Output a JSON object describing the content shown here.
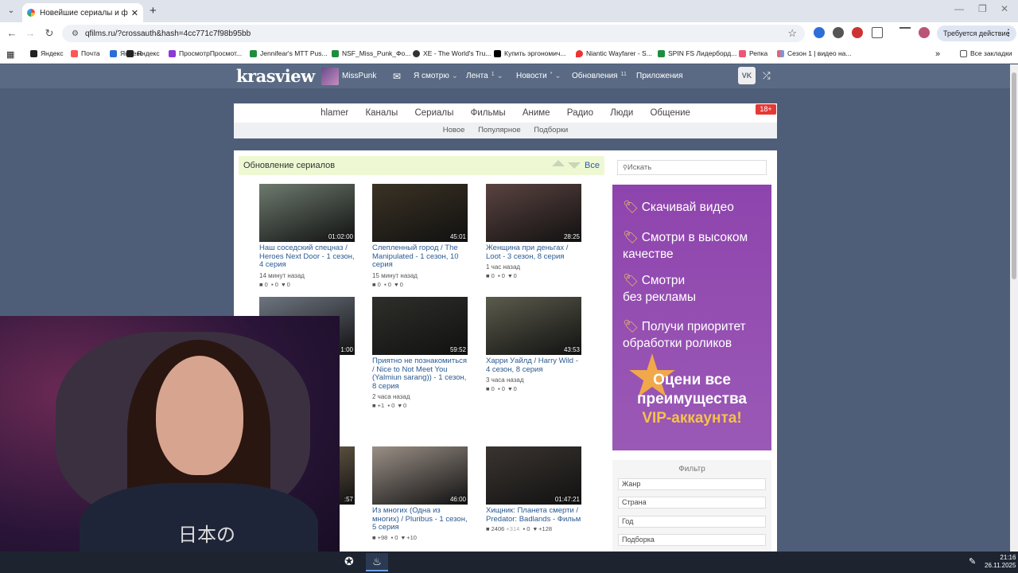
{
  "browser": {
    "tab_title": "Новейшие сериалы и фильмы",
    "url": "qfilms.ru/?crossauth&hash=4cc771c7f98b95bb",
    "action_required": "Требуется действие",
    "bookmarks": [
      "Яндекс",
      "Почта",
      "Яндекс",
      "ПросмотрПросмот...",
      "Jennifear's MTT Pus...",
      "NSF_Miss_Punk_Фо...",
      "XE - The World's Tru...",
      "Купить эргономич...",
      "Niantic Wayfarer - S...",
      "SPIN FS Лидерборд...",
      "Репка",
      "Сезон 1 | видео на..."
    ],
    "all_bookmarks": "Все закладки"
  },
  "header": {
    "logo": "krasview",
    "user": "MissPunk",
    "watching": "Я смотрю",
    "feed": "Лента",
    "feed_count": "1",
    "news": "Новости",
    "news_count": "*",
    "updates": "Обновления",
    "updates_count": "11",
    "apps": "Приложения",
    "vk": "VK"
  },
  "nav": {
    "primary": [
      "hlamer",
      "Каналы",
      "Сериалы",
      "Фильмы",
      "Аниме",
      "Радио",
      "Люди",
      "Общение"
    ],
    "secondary": [
      "Новое",
      "Популярное",
      "Подборки"
    ],
    "adult": "18+"
  },
  "section": {
    "title": "Обновление сериалов",
    "all": "Все"
  },
  "cards": [
    {
      "title": "Наш соседский спецназ / Heroes Next Door - 1 сезон, 4 серия",
      "time": "14 минут назад",
      "duration": "01:02:00",
      "views": "0",
      "comments": "0",
      "likes": "0",
      "color": "#6d7a6e"
    },
    {
      "title": "Слепленный город / The Manipulated - 1 сезон, 10 серия",
      "time": "15 минут назад",
      "duration": "45:01",
      "views": "0",
      "comments": "0",
      "likes": "0",
      "color": "#3b3224"
    },
    {
      "title": "Женщина при деньгах / Loot - 3 сезон, 8 серия",
      "time": "1 час назад",
      "duration": "28:25",
      "views": "0",
      "comments": "0",
      "likes": "0",
      "color": "#5a4340"
    },
    {
      "title": "",
      "time": "",
      "duration": "1:00",
      "views": "",
      "comments": "",
      "likes": "",
      "color": "#6e7580"
    },
    {
      "title": "Приятно не познакомиться / Nice to Not Meet You (Yalmiun sarang)) - 1 сезон, 8 серия",
      "time": "2 часа назад",
      "duration": "59:52",
      "views": "+1",
      "comments": "0",
      "likes": "0",
      "color": "#2e2f2a"
    },
    {
      "title": "Харри Уайлд / Harry Wild - 4 сезон, 8 серия",
      "time": "3 часа назад",
      "duration": "43:53",
      "views": "0",
      "comments": "0",
      "likes": "0",
      "color": "#5b5b4c"
    },
    {
      "title": "",
      "time": "",
      "duration": ":57",
      "views": "",
      "comments": "",
      "likes": "",
      "color": "#7a6a52"
    },
    {
      "title": "Из многих (Одна из многих) / Pluribus - 1 сезон, 5 серия",
      "time": "",
      "duration": "46:00",
      "views": "+98",
      "comments": "0",
      "likes": "+10",
      "color": "#9a8f86"
    },
    {
      "title": "Хищник: Планета смерти / Predator: Badlands - Фильм",
      "time": "",
      "duration": "01:47:21",
      "views": "2406",
      "comments": "0",
      "likes": "+128",
      "extra": "+314",
      "color": "#3a3430"
    }
  ],
  "sidebar": {
    "search_placeholder": "Искать",
    "promo_items": [
      "Скачивай видео",
      "Смотри в высоком",
      "качестве",
      "Смотри",
      "без рекламы",
      "Получи приоритет",
      "обработки роликов"
    ],
    "vip_line1": "Оцени все",
    "vip_line2": "преимущества",
    "vip_line3": "VIP-аккаунта!",
    "filter_title": "Фильтр",
    "filters": [
      "Жанр",
      "Страна",
      "Год",
      "Подборка"
    ]
  },
  "webcam": {
    "shirt_text": "日本の"
  },
  "taskbar": {
    "time": "21:16",
    "date": "26.11.2025"
  }
}
